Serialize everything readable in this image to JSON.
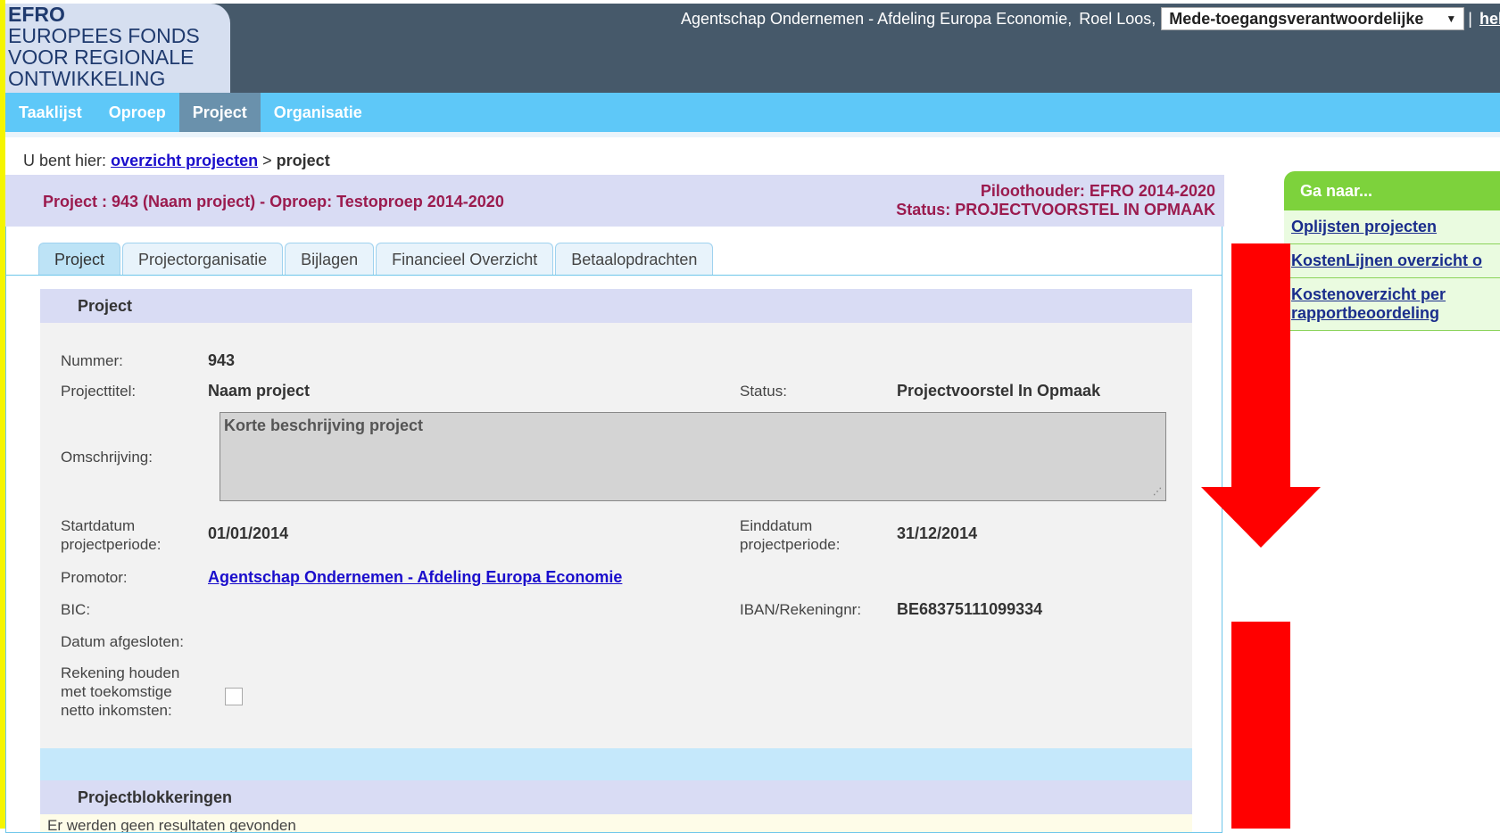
{
  "logo": {
    "lines": [
      "EFRO",
      "EUROPEES FONDS",
      "VOOR REGIONALE",
      "ONTWIKKELING"
    ]
  },
  "header": {
    "organisation": "Agentschap Ondernemen - Afdeling Europa Economie,",
    "user": "Roel Loos,",
    "role_selected": "Mede-toegangsverantwoordelijke",
    "separator": "|",
    "help_label": "help"
  },
  "nav": {
    "items": [
      "Taaklijst",
      "Oproep",
      "Project",
      "Organisatie"
    ],
    "active": "Project"
  },
  "breadcrumb": {
    "prefix": "U bent hier:",
    "link": "overzicht projecten",
    "separator": ">",
    "current": "project"
  },
  "project_band": {
    "title": "Project : 943 (Naam project) - Oproep: Testoproep 2014-2020",
    "pilot_holder": "Piloothouder: EFRO 2014-2020",
    "status": "Status: PROJECTVOORSTEL IN OPMAAK"
  },
  "tabs": [
    "Project",
    "Projectorganisatie",
    "Bijlagen",
    "Financieel Overzicht",
    "Betaalopdrachten"
  ],
  "section": {
    "title": "Project",
    "fields": {
      "nummer_label": "Nummer:",
      "nummer_value": "943",
      "titel_label": "Projecttitel:",
      "titel_value": "Naam project",
      "status_label": "Status:",
      "status_value": "Projectvoorstel In Opmaak",
      "omschrijving_label": "Omschrijving:",
      "omschrijving_value": "Korte beschrijving project",
      "start_label_1": "Startdatum",
      "start_label_2": "projectperiode:",
      "start_value": "01/01/2014",
      "eind_label_1": "Einddatum",
      "eind_label_2": "projectperiode:",
      "eind_value": "31/12/2014",
      "promotor_label": "Promotor:",
      "promotor_value": "Agentschap Ondernemen - Afdeling Europa Economie",
      "bic_label": "BIC:",
      "iban_label": "IBAN/Rekeningnr:",
      "iban_value": "BE68375111099334",
      "afgesloten_label": "Datum afgesloten:",
      "rekening_label_1": "Rekening houden",
      "rekening_label_2": "met toekomstige",
      "rekening_label_3": "netto inkomsten:"
    },
    "blocks_title": "Projectblokkeringen",
    "no_results": "Er werden geen resultaten gevonden"
  },
  "side": {
    "title": "Ga naar...",
    "links": [
      "Oplijsten projecten",
      "KostenLijnen overzicht o",
      "Kostenoverzicht per rapportbeoordeling"
    ]
  },
  "colors": {
    "header_bg": "#46596a",
    "nav_bg": "#5ec8f8",
    "accent_title": "#9b1b4e",
    "side_header": "#7dd23c",
    "annotation": "#ff0000"
  }
}
